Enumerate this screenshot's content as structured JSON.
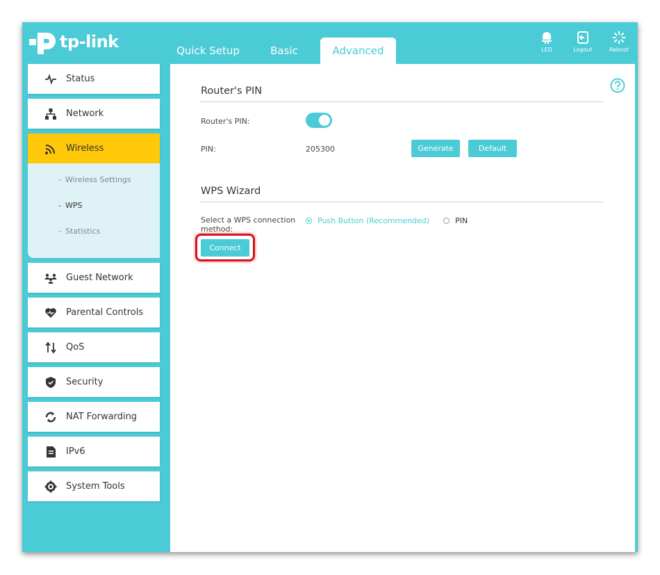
{
  "brand": {
    "logo_text": "tp-link"
  },
  "tabs": [
    {
      "label": "Quick Setup"
    },
    {
      "label": "Basic"
    },
    {
      "label": "Advanced",
      "active": true
    }
  ],
  "header_buttons": [
    {
      "label": "LED",
      "icon": "led-bulb-icon"
    },
    {
      "label": "Logout",
      "icon": "logout-icon"
    },
    {
      "label": "Reboot",
      "icon": "reboot-icon"
    }
  ],
  "sidebar": {
    "items": [
      {
        "label": "Status",
        "icon": "pulse-icon"
      },
      {
        "label": "Network",
        "icon": "network-icon"
      },
      {
        "label": "Wireless",
        "icon": "wireless-icon",
        "active": true
      },
      {
        "label": "Guest Network",
        "icon": "guest-network-icon"
      },
      {
        "label": "Parental Controls",
        "icon": "heart-icon"
      },
      {
        "label": "QoS",
        "icon": "updown-arrows-icon"
      },
      {
        "label": "Security",
        "icon": "shield-icon"
      },
      {
        "label": "NAT Forwarding",
        "icon": "nat-icon"
      },
      {
        "label": "IPv6",
        "icon": "ipv6-icon"
      },
      {
        "label": "System Tools",
        "icon": "gear-icon"
      }
    ],
    "wireless_sub": [
      {
        "label": "Wireless Settings"
      },
      {
        "label": "WPS",
        "current": true
      },
      {
        "label": "Statistics"
      }
    ]
  },
  "router_pin": {
    "title": "Router's PIN",
    "toggle_label": "Router's PIN:",
    "toggle_on": true,
    "pin_label": "PIN:",
    "pin_value": "205300",
    "generate_label": "Generate",
    "default_label": "Default"
  },
  "wps_wizard": {
    "title": "WPS Wizard",
    "method_label": "Select a WPS connection method:",
    "options": [
      {
        "label": "Push Button (Recommended)",
        "selected": true
      },
      {
        "label": "PIN",
        "selected": false
      }
    ],
    "connect_label": "Connect"
  },
  "colors": {
    "accent": "#4acbd6",
    "active_nav": "#ffc808",
    "highlight": "#d9121b"
  }
}
